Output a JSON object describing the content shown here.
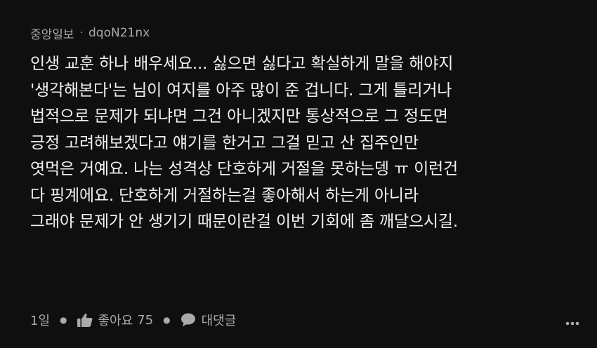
{
  "comment": {
    "source": "중앙일보",
    "separator": "·",
    "username": "dqoN21nx",
    "body_lines": [
      "인생 교훈 하나 배우세요... 싫으면 싫다고 확실하게 말을 해야지",
      "'생각해본다'는 님이 여지를 아주 많이 준 겁니다. 그게 틀리거나",
      "법적으로 문제가 되냐면 그건 아니겠지만 통상적으로 그 정도면",
      "긍정 고려해보겠다고 얘기를 한거고 그걸 믿고 산 집주인만",
      "엿먹은 거예요. 나는 성격상 단호하게 거절을 못하는뎅 ㅠ 이런건",
      "다 핑계에요. 단호하게 거절하는걸 좋아해서 하는게 아니라",
      "그래야 문제가 안 생기기 때문이란걸 이번 기회에 좀 깨달으시길."
    ],
    "actions": {
      "time": "1일",
      "like_label": "좋아요",
      "like_count": "75",
      "reply_label": "대댓글",
      "like_icon": "thumbs-up-icon",
      "reply_icon": "speech-bubble-icon",
      "more_icon": "more-dots-icon"
    }
  }
}
